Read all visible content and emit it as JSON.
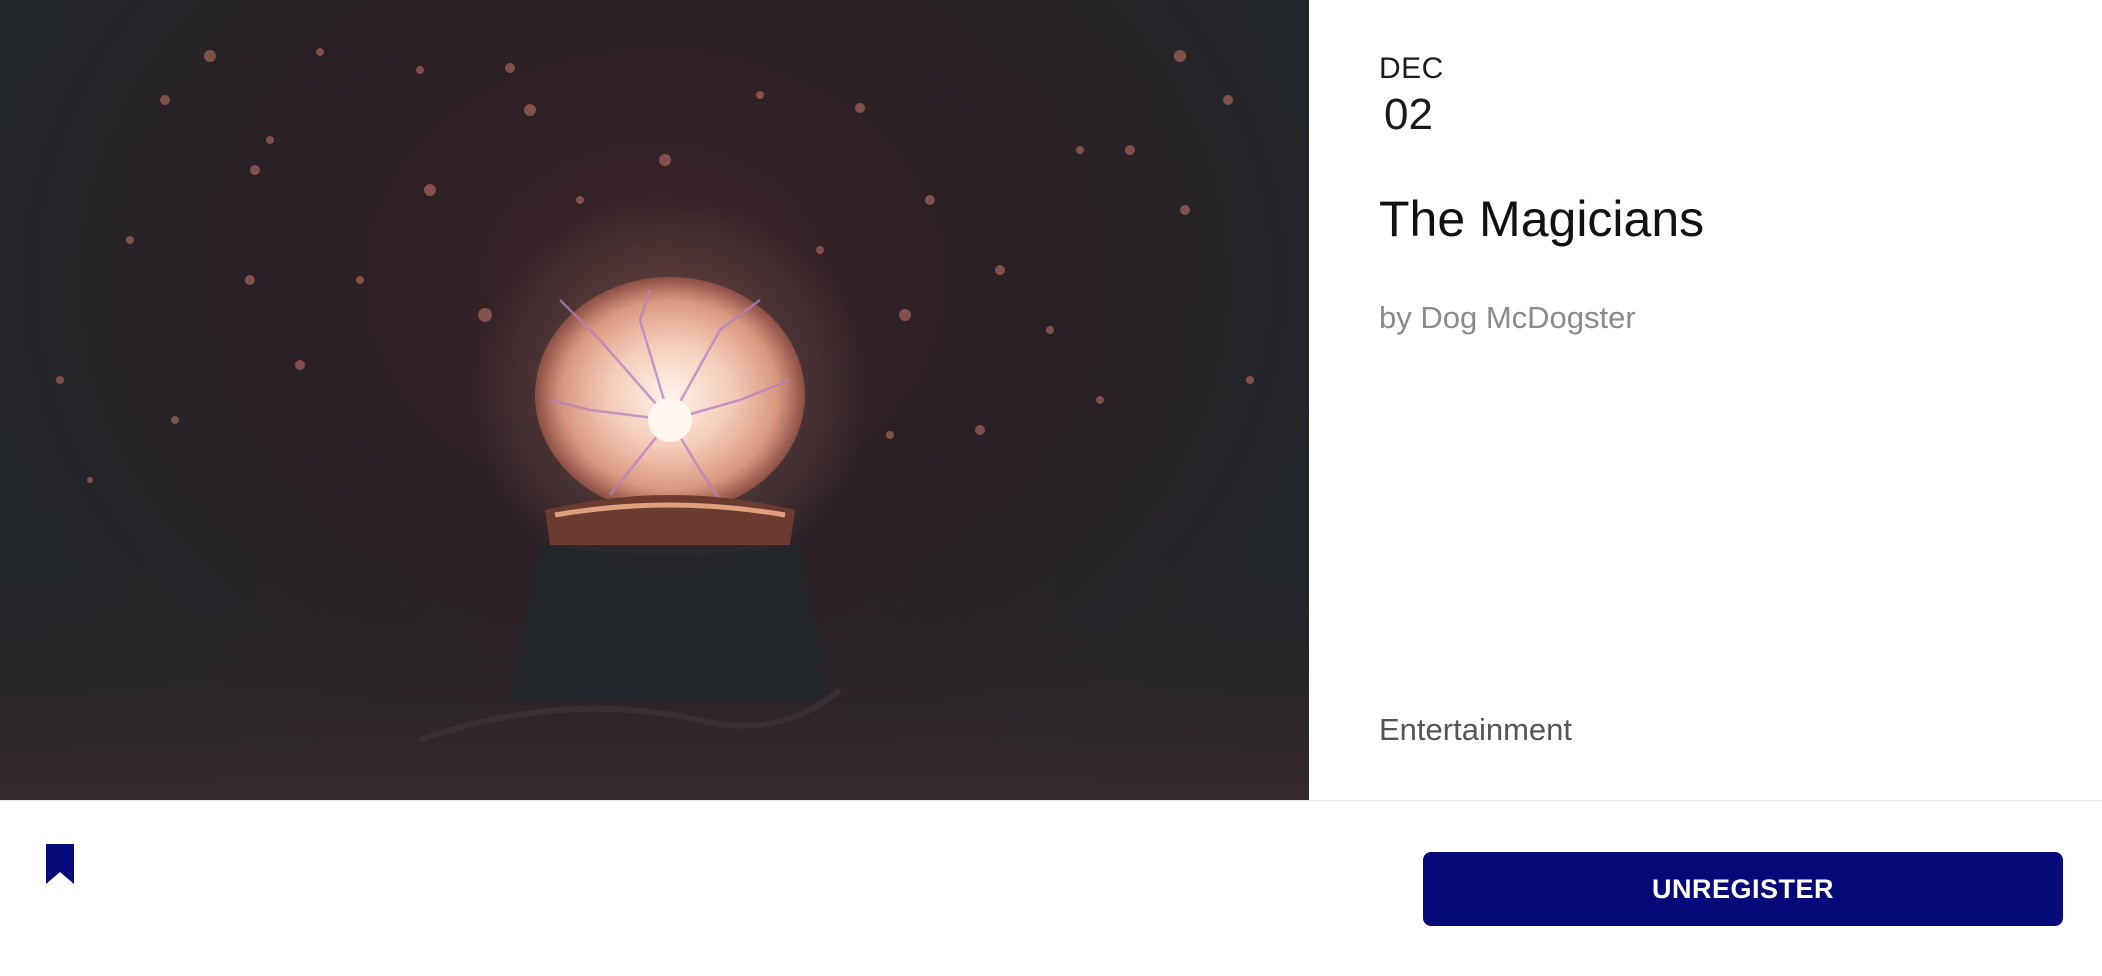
{
  "event": {
    "image_alt": "Plasma globe in the dark",
    "date_month": "DEC",
    "date_day": "02",
    "title": "The Magicians",
    "author": "by Dog McDogster",
    "category": "Entertainment"
  },
  "footer": {
    "bookmark_icon": "bookmark-icon",
    "unregister_label": "UNREGISTER"
  },
  "colors": {
    "accent": "#060a78",
    "title": "#111111",
    "muted": "#8a8a8a"
  }
}
